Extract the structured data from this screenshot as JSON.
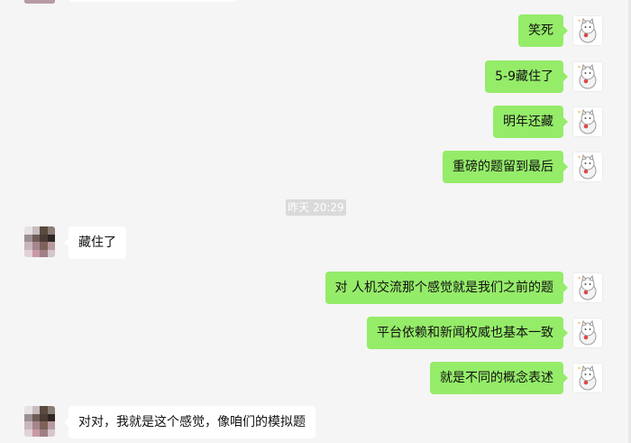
{
  "chat": {
    "timestamp": "昨天 20:29",
    "messages": [
      {
        "side": "right",
        "text": "笑死"
      },
      {
        "side": "right",
        "text": "5-9藏住了"
      },
      {
        "side": "right",
        "text": "明年还藏"
      },
      {
        "side": "right",
        "text": "重磅的题留到最后"
      },
      {
        "side": "left",
        "text": "藏住了"
      },
      {
        "side": "right",
        "text": "对 人机交流那个感觉就是我们之前的题"
      },
      {
        "side": "right",
        "text": "平台依赖和新闻权威也基本一致"
      },
      {
        "side": "right",
        "text": "就是不同的概念表述"
      },
      {
        "side": "left",
        "text": "对对，我就是这个感觉，像咱们的模拟题"
      }
    ]
  },
  "colors": {
    "self_bubble": "#95ec69",
    "other_bubble": "#ffffff",
    "background": "#f5f5f5"
  },
  "icons": {
    "self_avatar": "cat-avatar-icon",
    "other_avatar": "blurred-avatar-icon"
  }
}
